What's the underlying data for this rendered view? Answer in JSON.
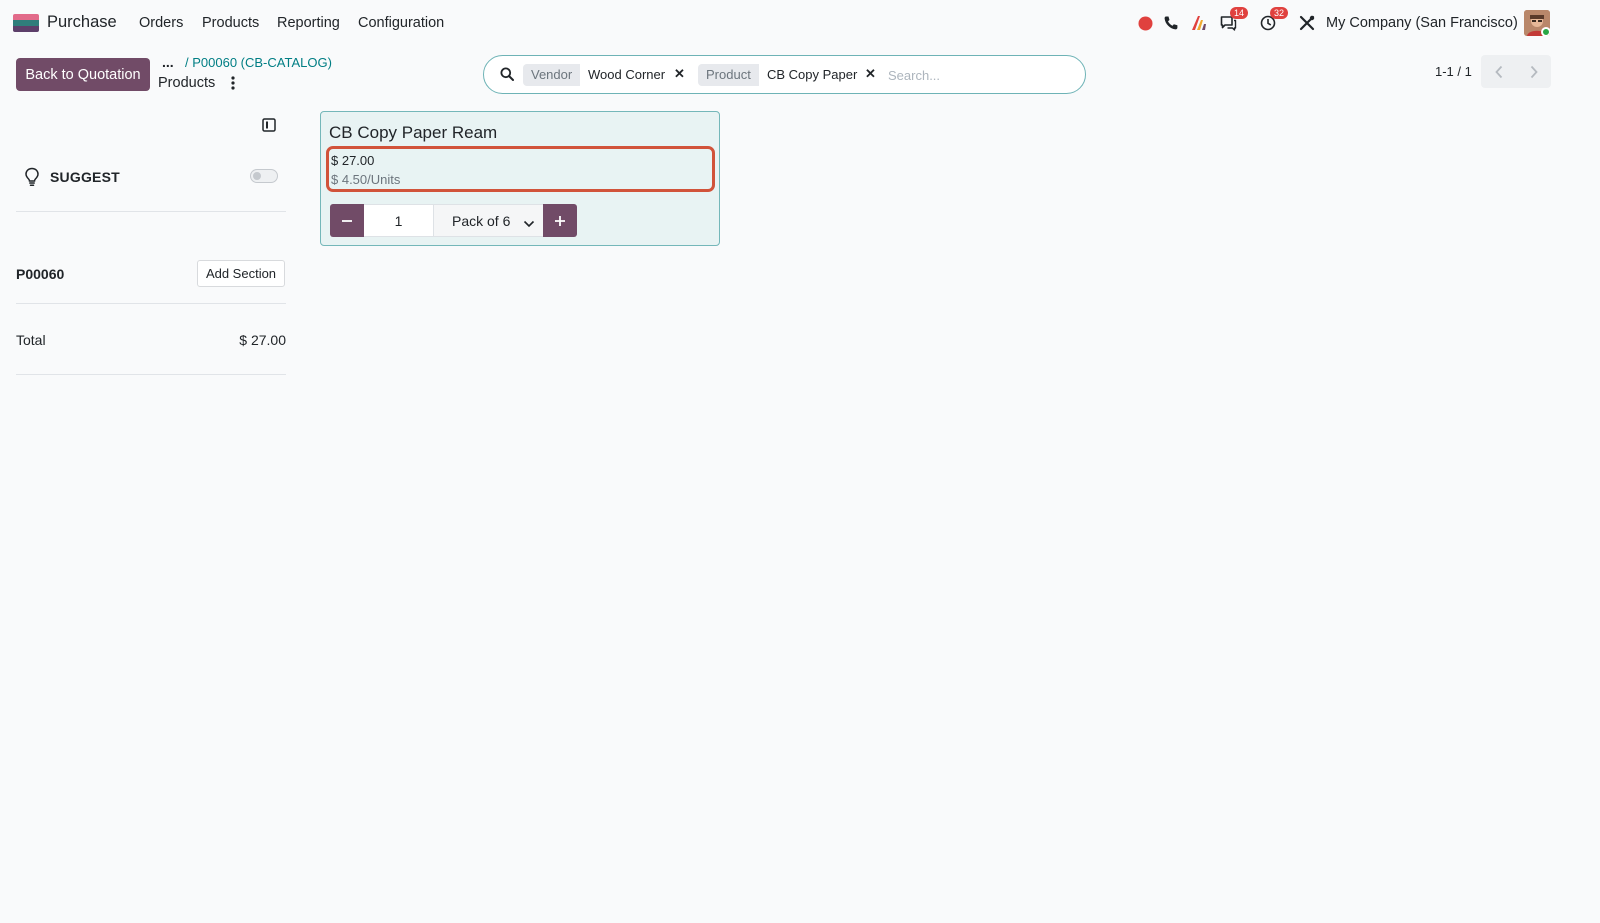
{
  "navbar": {
    "app_name": "Purchase",
    "menu": [
      "Orders",
      "Products",
      "Reporting",
      "Configuration"
    ],
    "discuss_badge": "14",
    "activity_badge": "32",
    "company": "My Company (San Francisco)"
  },
  "control_panel": {
    "back_button": "Back to Quotation",
    "breadcrumb_ellipsis": "...",
    "breadcrumb_parent": "/ P00060 (CB-CATALOG)",
    "breadcrumb_current": "Products"
  },
  "search": {
    "facets": [
      {
        "label": "Vendor",
        "value": "Wood Corner"
      },
      {
        "label": "Product",
        "value": "CB Copy Paper"
      }
    ],
    "placeholder": "Search..."
  },
  "pager": {
    "value": "1-1 / 1"
  },
  "sidebar": {
    "suggest_label": "SUGGEST",
    "suggest_enabled": false,
    "order_ref": "P00060",
    "add_section_label": "Add Section",
    "total_label": "Total",
    "total_value": "$ 27.00"
  },
  "product_card": {
    "name": "CB Copy Paper Ream",
    "price": "$ 27.00",
    "unit_price": "$ 4.50/Units",
    "quantity": "1",
    "uom": "Pack of 6"
  },
  "colors": {
    "primary": "#714b67",
    "accent": "#017e84",
    "highlight": "#d1533a"
  }
}
